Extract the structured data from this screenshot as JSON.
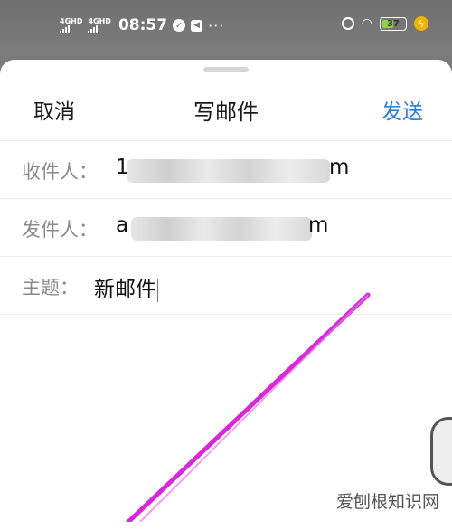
{
  "status_bar": {
    "network_1": "4GHD",
    "network_2": "4GHD",
    "time": "08:57",
    "more": "···",
    "battery": "37"
  },
  "compose": {
    "cancel_label": "取消",
    "title": "写邮件",
    "send_label": "发送",
    "to_label": "收件人：",
    "to_value_first": "1",
    "to_value_last": "m",
    "from_label": "发件人：",
    "from_value_first": "a",
    "from_value_last": "m",
    "subject_label": "主题：",
    "subject_value": "新邮件"
  },
  "colors": {
    "accent": "#2f7fd1",
    "stroke": "#d62ad6"
  },
  "watermark": "爱刨根知识网"
}
